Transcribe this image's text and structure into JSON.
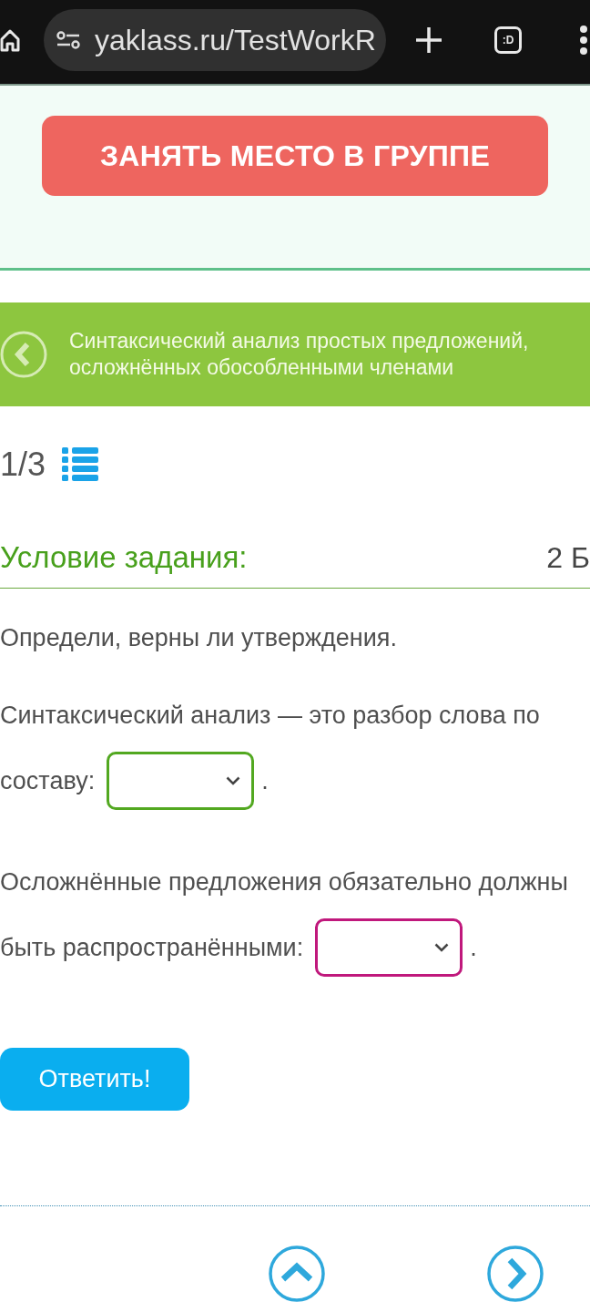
{
  "browser": {
    "url": "yaklass.ru/TestWorkR",
    "tab_switcher": ":D"
  },
  "promo": {
    "button": "ЗАНЯТЬ МЕСТО В ГРУППЕ"
  },
  "banner": {
    "title": "Синтаксический анализ простых предложений, осложнённых обособленными членами"
  },
  "progress": {
    "counter": "1/3"
  },
  "task": {
    "heading": "Условие задания:",
    "points": "2 Б",
    "instruction": "Определи, верны ли утверждения.",
    "statements": [
      {
        "text": "Синтаксический анализ — это разбор слова по",
        "text_before_blank": "составу:",
        "blank": {
          "kind": "select",
          "color": "#52a820"
        },
        "end": "."
      },
      {
        "text": "Осложнённые предложения обязательно должны",
        "text_before_blank": "быть распространёнными:",
        "blank": {
          "kind": "select",
          "color": "#c0187c"
        },
        "end": "."
      }
    ],
    "submit": "Ответить!"
  }
}
